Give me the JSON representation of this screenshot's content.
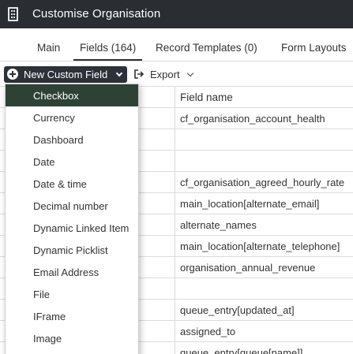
{
  "window": {
    "title": "Customise Organisation",
    "icon": "building-icon"
  },
  "tabs": [
    {
      "label": "Main"
    },
    {
      "label": "Fields (164)",
      "active": true
    },
    {
      "label": "Record Templates (0)"
    },
    {
      "label": "Form Layouts"
    }
  ],
  "toolbar": {
    "new_field_label": "New Custom Field",
    "export_label": "Export"
  },
  "grid": {
    "column_header": "Field name",
    "rows": [
      "cf_organisation_account_health",
      "",
      "",
      "cf_organisation_agreed_hourly_rate",
      "main_location[alternate_email]",
      "alternate_names",
      "main_location[alternate_telephone]",
      "organisation_annual_revenue",
      "",
      "queue_entry[updated_at]",
      "assigned_to",
      "queue_entry[queue[name]]"
    ]
  },
  "dropdown": {
    "selected": "Checkbox",
    "items": [
      "Checkbox",
      "Currency",
      "Dashboard",
      "Date",
      "Date & time",
      "Decimal number",
      "Dynamic Linked Item",
      "Dynamic Picklist",
      "Email Address",
      "File",
      "IFrame",
      "Image"
    ]
  },
  "colors": {
    "titlebar": "#2a2e33",
    "button_dark": "#2d3238",
    "selected_item": "#2d4235"
  }
}
